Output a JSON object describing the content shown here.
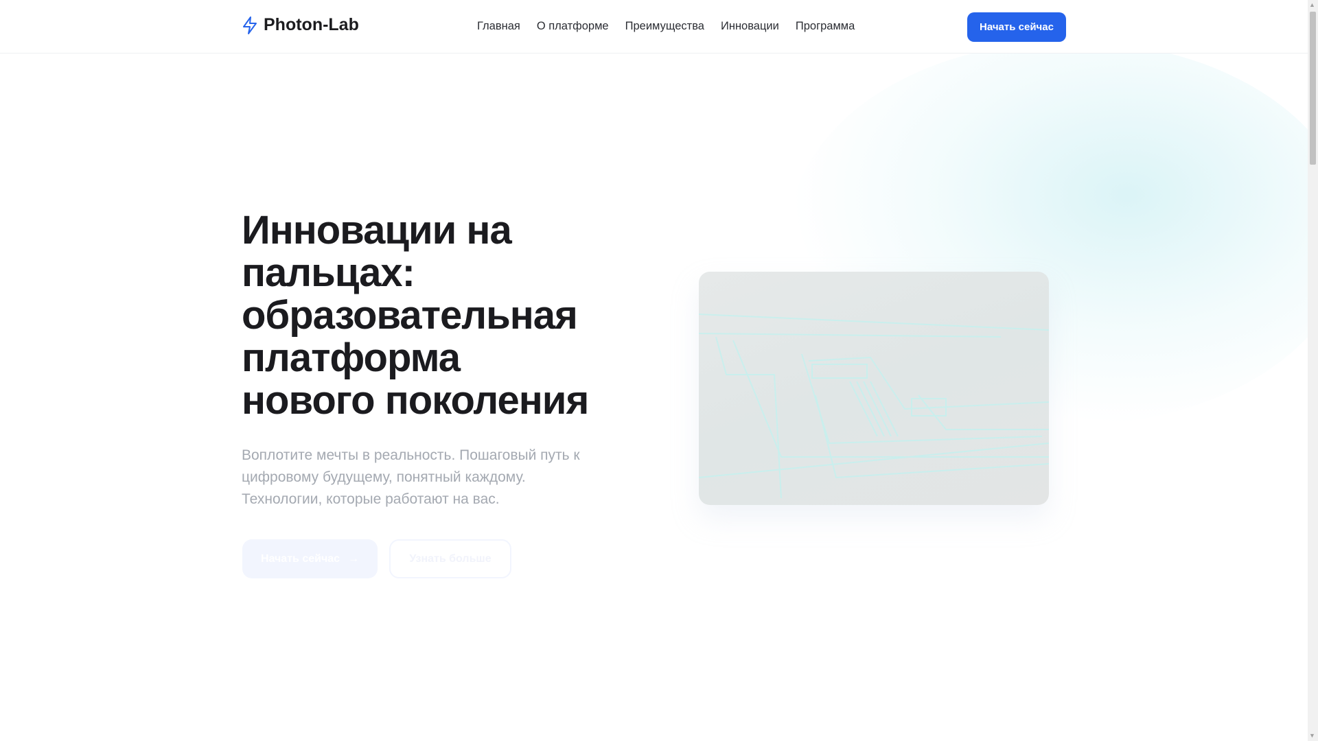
{
  "header": {
    "logo": "Photon-Lab",
    "nav": [
      "Главная",
      "О платформе",
      "Преимущества",
      "Инновации",
      "Программа"
    ],
    "cta": "Начать сейчас"
  },
  "hero": {
    "title": "Инновации на пальцах: образовательная платформа нового поколения",
    "lead": "Воплотите мечты в реальность. Пошаговый путь к цифровому будущему, понятный каждому. Технологии, которые работают на вас.",
    "primary_button": "Начать сейчас",
    "secondary_button": "Узнать больше"
  },
  "colors": {
    "accent": "#2563eb",
    "text": "#1b1b1f",
    "muted": "#a4a9b1"
  }
}
